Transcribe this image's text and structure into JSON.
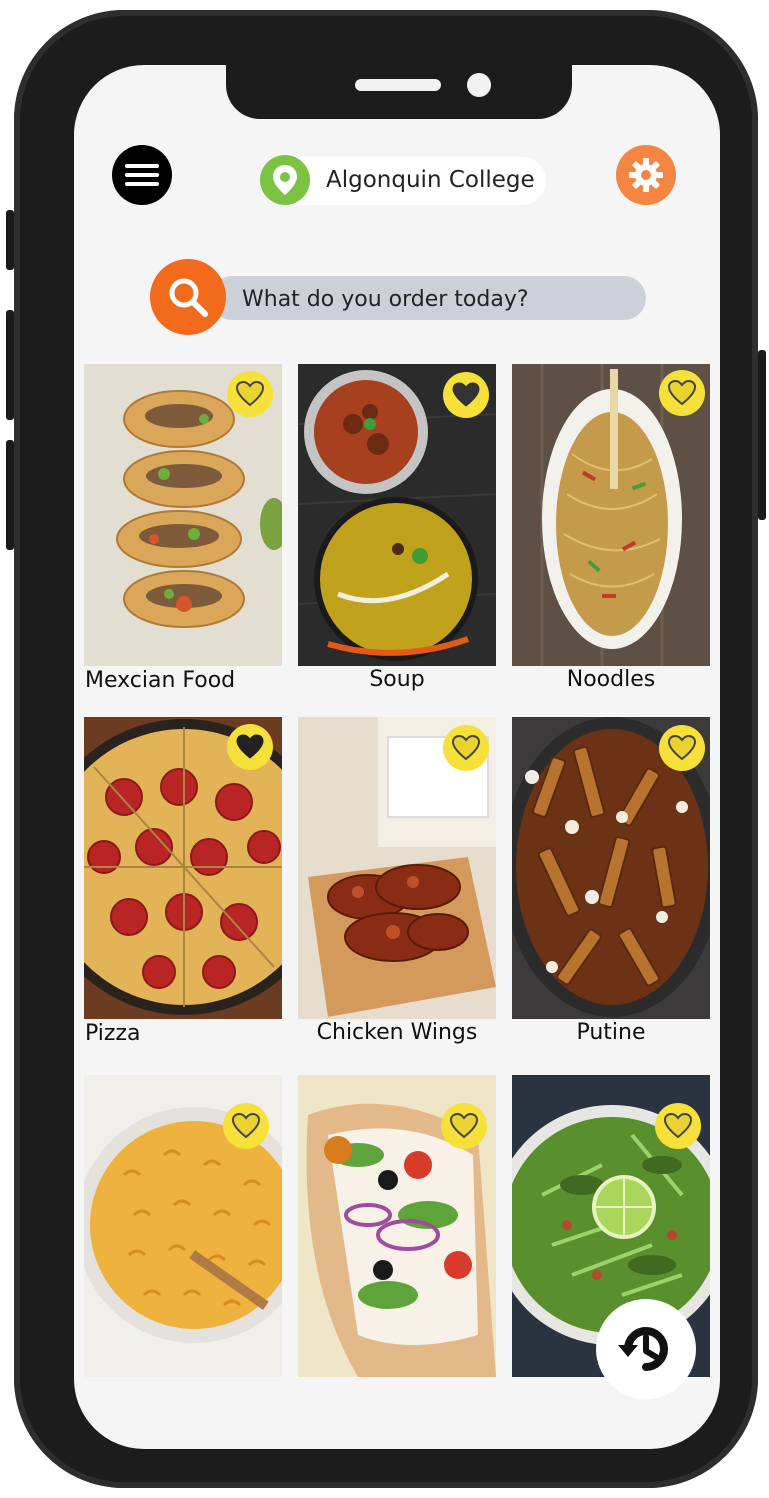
{
  "header": {
    "location": "Algonquin College",
    "menu_icon": "hamburger-menu-icon",
    "location_icon": "map-pin-icon",
    "settings_icon": "gear-icon"
  },
  "search": {
    "placeholder": "What do you order today?",
    "icon": "search-icon"
  },
  "foods": [
    {
      "label": "Mexcian Food",
      "favorite_icon": "heart-icon"
    },
    {
      "label": "Soup",
      "favorite_icon": "heart-icon"
    },
    {
      "label": "Noodles",
      "favorite_icon": "heart-icon"
    },
    {
      "label": "Pizza",
      "favorite_icon": "heart-icon"
    },
    {
      "label": "Chicken Wings",
      "favorite_icon": "heart-icon"
    },
    {
      "label": "Putine",
      "favorite_icon": "heart-icon"
    },
    {
      "label": "",
      "favorite_icon": "heart-icon"
    },
    {
      "label": "",
      "favorite_icon": "heart-icon"
    },
    {
      "label": "",
      "favorite_icon": "heart-icon"
    }
  ],
  "history_icon": "history-clock-icon",
  "colors": {
    "accent_orange": "#f26a1b",
    "settings_orange": "#f48542",
    "location_green": "#7cc243",
    "heart_yellow": "#f5e13a",
    "search_bg": "#ccd1d9"
  }
}
